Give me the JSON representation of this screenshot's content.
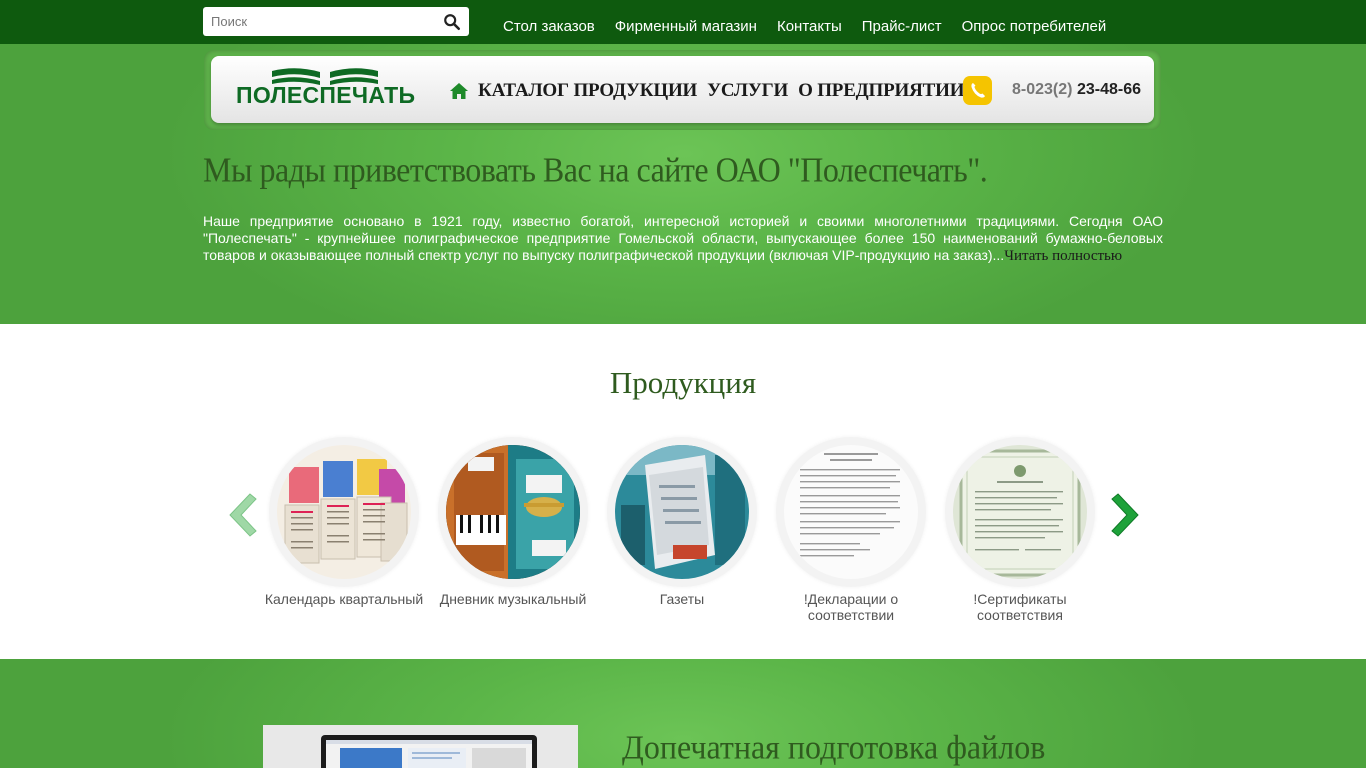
{
  "search": {
    "placeholder": "Поиск"
  },
  "top_nav": [
    "Стол заказов",
    "Фирменный магазин",
    "Контакты",
    "Прайс-лист",
    "Опрос потребителей"
  ],
  "header": {
    "logo_text": "ПОЛЕСПЕЧАТЬ",
    "nav": [
      "КАТАЛОГ ПРОДУКЦИИ",
      "УСЛУГИ",
      "О ПРЕДПРИЯТИИ"
    ],
    "phone_prefix": "8-023(2)",
    "phone_number": "23-48-66"
  },
  "hero": {
    "title": "Мы рады приветствовать Вас на сайте ОАО \"Полеспечать\".",
    "intro": " Наше предприятие основано в 1921 году, известно богатой, интересной историей и своими многолетними традициями. Сегодня ОАО \"Полеспечать\" - крупнейшее полиграфическое предприятие Гомельской области, выпускающее более 150 наименований бумажно-беловых товаров и оказывающее полный спектр услуг по выпуску полиграфической продукции (включая VIP-продукцию на заказ)...",
    "read_more": "Читать полностью"
  },
  "products": {
    "title": "Продукция",
    "items": [
      {
        "label": "Календарь квартальный"
      },
      {
        "label": "Дневник музыкальный"
      },
      {
        "label": "Газеты"
      },
      {
        "label": "!Декларации о соответствии"
      },
      {
        "label": "!Сертификаты соответствия"
      }
    ]
  },
  "bottom": {
    "title": "Допечатная подготовка файлов"
  },
  "colors": {
    "topbar": "#0e5a0e",
    "hero_green": "#5bb548",
    "heading": "#2f5b1f",
    "phone_icon": "#f5c400"
  }
}
